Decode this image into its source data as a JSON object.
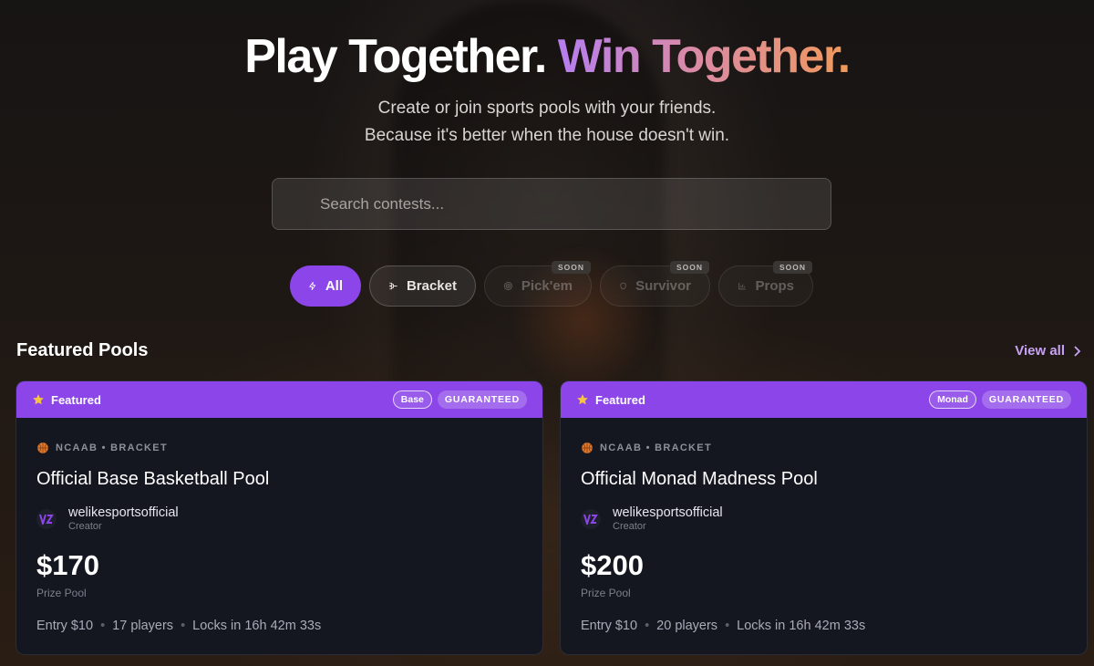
{
  "hero": {
    "title_main": "Play Together.",
    "title_accent": "Win Together.",
    "subtitle_line1": "Create or join sports pools with your friends.",
    "subtitle_line2": "Because it's better when the house doesn't win."
  },
  "search": {
    "placeholder": "Search contests..."
  },
  "filters": [
    {
      "label": "All",
      "icon": "lightning-icon",
      "state": "active"
    },
    {
      "label": "Bracket",
      "icon": "bracket-icon",
      "state": "normal"
    },
    {
      "label": "Pick'em",
      "icon": "target-icon",
      "state": "disabled",
      "badge": "SOON"
    },
    {
      "label": "Survivor",
      "icon": "shield-icon",
      "state": "disabled",
      "badge": "SOON"
    },
    {
      "label": "Props",
      "icon": "bar-chart-icon",
      "state": "disabled",
      "badge": "SOON"
    }
  ],
  "featured": {
    "title": "Featured Pools",
    "view_all": "View all",
    "cards": [
      {
        "badge": "Featured",
        "chain": "Base",
        "guarantee": "GUARANTEED",
        "meta": "NCAAB • BRACKET",
        "name": "Official Base Basketball Pool",
        "creator": "welikesportsofficial",
        "creator_role": "Creator",
        "prize": "$170",
        "prize_label": "Prize Pool",
        "entry": "Entry $10",
        "players": "17 players",
        "locks": "Locks in 16h 42m 33s"
      },
      {
        "badge": "Featured",
        "chain": "Monad",
        "guarantee": "GUARANTEED",
        "meta": "NCAAB • BRACKET",
        "name": "Official Monad Madness Pool",
        "creator": "welikesportsofficial",
        "creator_role": "Creator",
        "prize": "$200",
        "prize_label": "Prize Pool",
        "entry": "Entry $10",
        "players": "20 players",
        "locks": "Locks in 16h 42m 33s"
      }
    ]
  },
  "colors": {
    "accent": "#8b45e8",
    "card_bg": "#141620",
    "link": "#c7a3f5"
  }
}
